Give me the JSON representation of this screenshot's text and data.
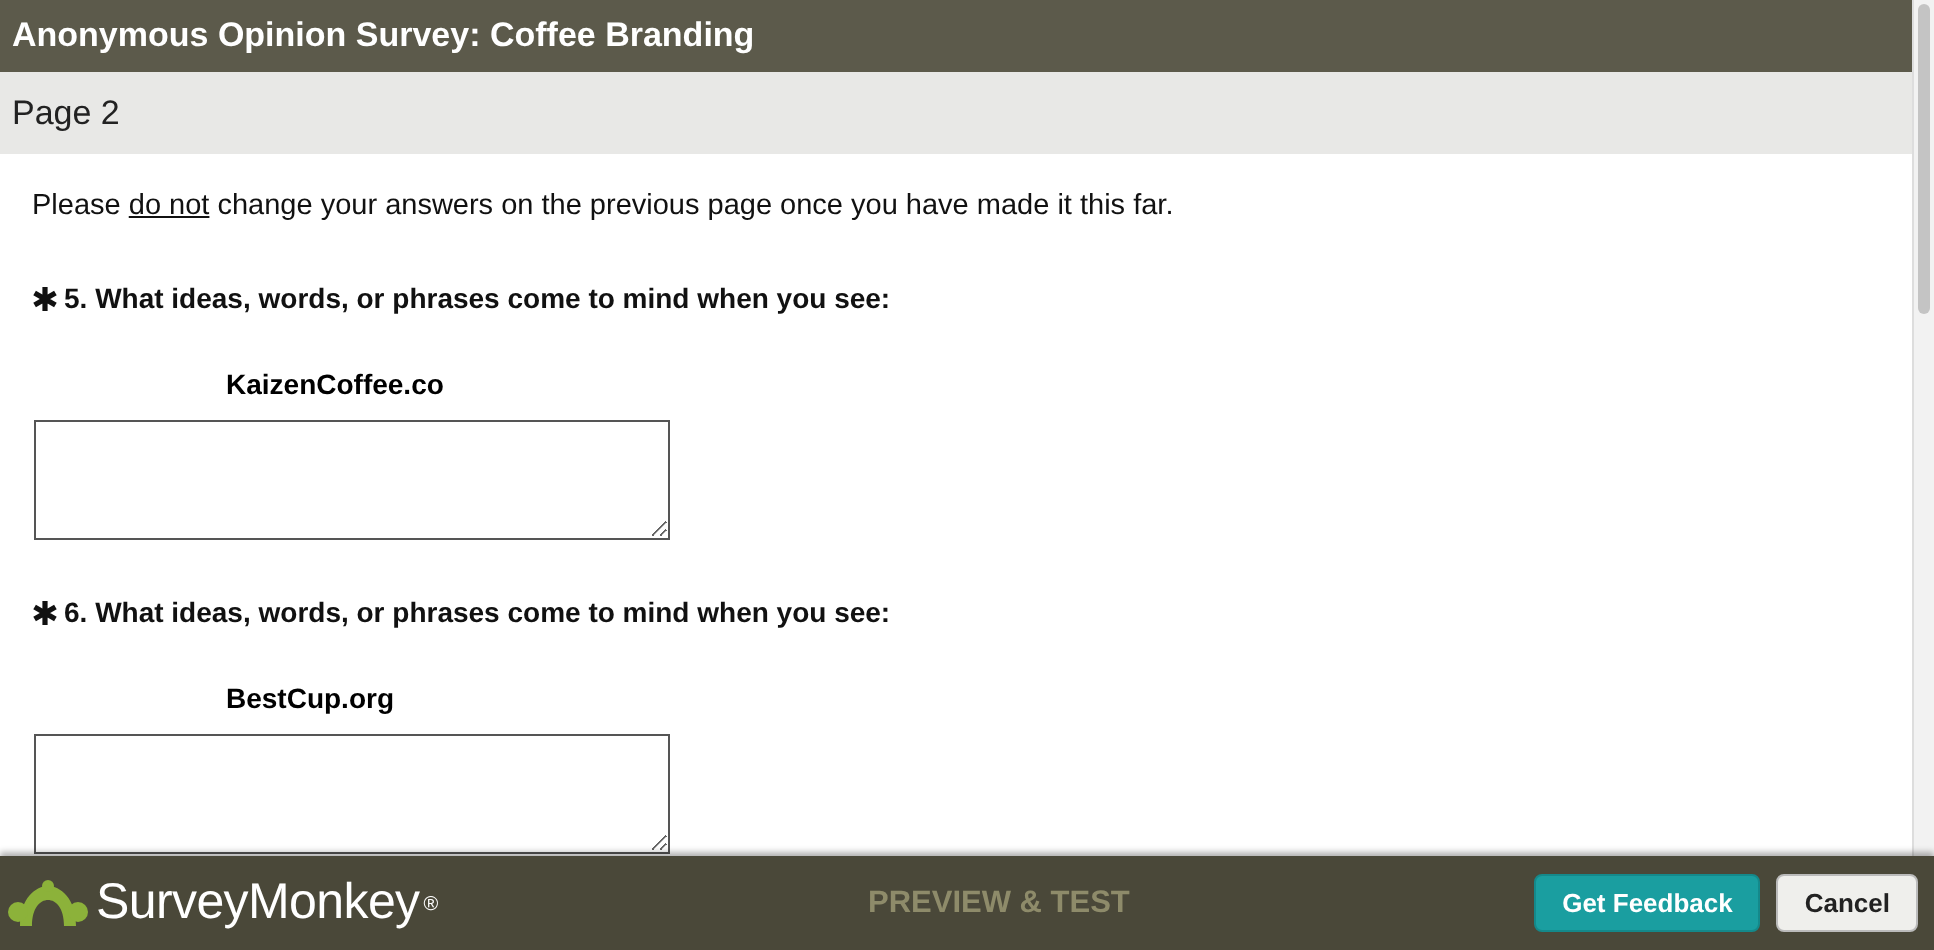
{
  "window": {
    "title": "Anonymous Opinion Survey: Coffee Branding"
  },
  "page": {
    "title": "Page 2"
  },
  "intro": {
    "before": "Please ",
    "underlined": "do not",
    "after": " change your answers on the previous page once you have made it this far."
  },
  "questions": [
    {
      "required": true,
      "text": "5. What ideas, words, or phrases come to mind when you see:",
      "subject": "KaizenCoffee.co"
    },
    {
      "required": true,
      "text": "6. What ideas, words, or phrases come to mind when you see:",
      "subject": "BestCup.org"
    }
  ],
  "footer": {
    "brand": "SurveyMonkey",
    "registered": "®",
    "mode": "PREVIEW & TEST",
    "buttons": [
      {
        "label": "Get Feedback",
        "kind": "primary"
      },
      {
        "label": "Cancel",
        "kind": "secondary"
      }
    ]
  }
}
